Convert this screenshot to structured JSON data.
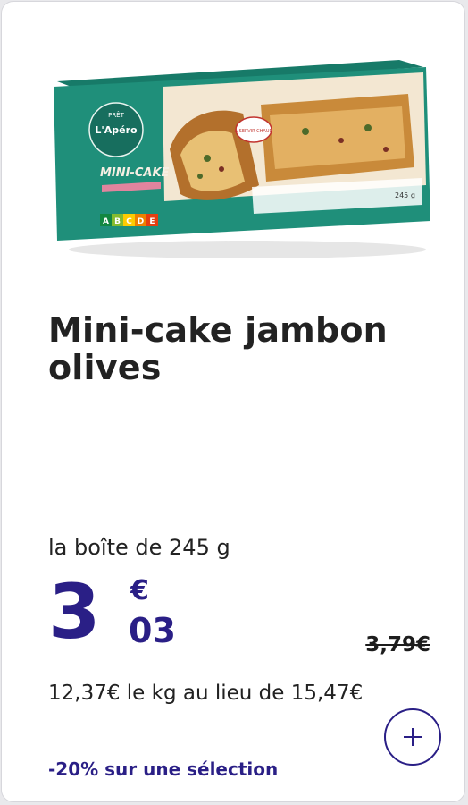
{
  "product": {
    "title": "Mini-cake jambon olives",
    "package": "la boîte de 245 g",
    "price_int": "3",
    "price_currency": "€",
    "price_dec": "03",
    "old_price": "3,79€",
    "unit_price": "12,37€ le kg au lieu de 15,47€",
    "promo": "-20% sur une sélection"
  },
  "box_art": {
    "brand_top": "PRÊT",
    "brand": "L'Apéro",
    "name": "MINI-CAKE",
    "flag": "À SERVIR CHAUD",
    "weight": "245 g",
    "nutri": [
      "A",
      "B",
      "C",
      "D",
      "E"
    ]
  },
  "colors": {
    "brand_blue": "#2a1f86",
    "box_teal": "#1f8f7a"
  }
}
